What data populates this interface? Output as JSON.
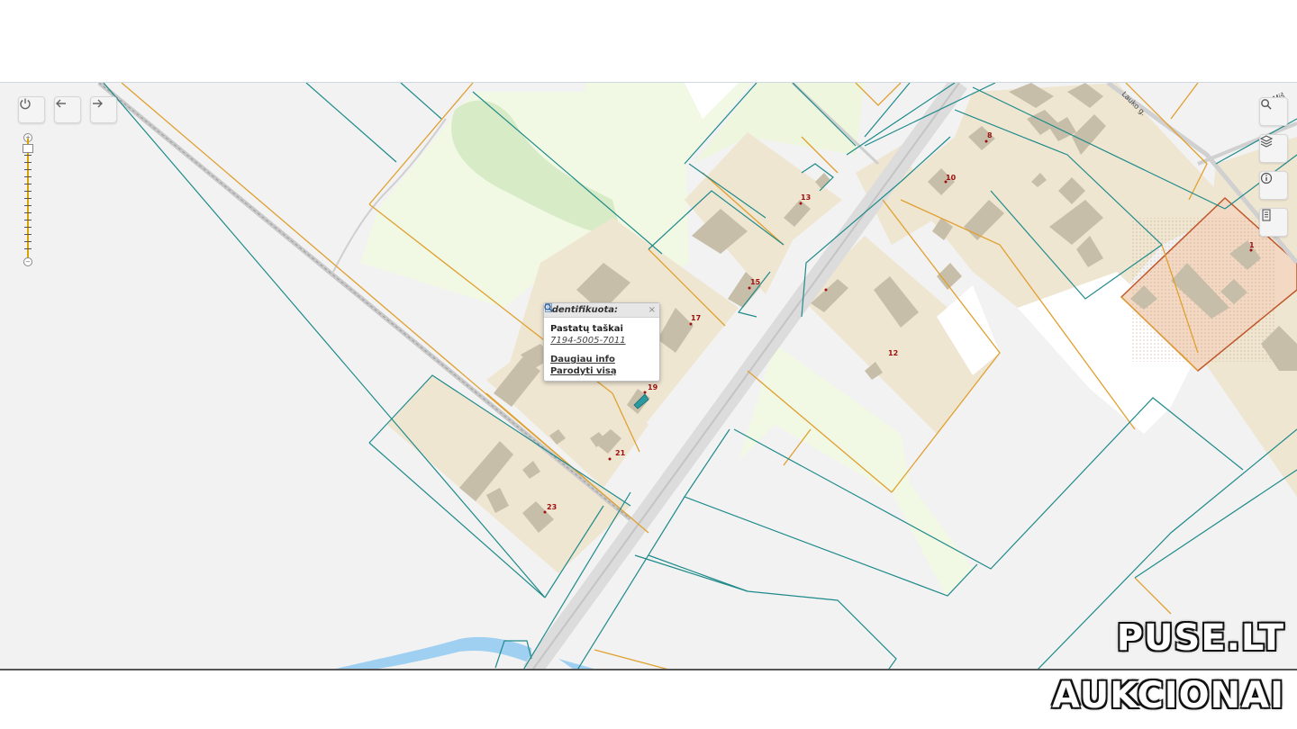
{
  "map": {
    "popup": {
      "header": "Identifikuota:",
      "close": "×",
      "title": "Pastatų taškai",
      "id_link": "7194-5005-7011",
      "more_info": "Daugiau info",
      "show_all": "Parodyti visą"
    },
    "address_labels": {
      "n1": "1",
      "n8": "8",
      "n10": "10",
      "n12": "12",
      "n13": "13",
      "n15": "15",
      "n17": "17",
      "n19": "19",
      "n21": "21",
      "n23": "23"
    },
    "streets": {
      "lauko": "Lauko g.",
      "misko": "Miš"
    },
    "controls": {
      "power_icon": "power-icon",
      "back_icon": "arrow-left-icon",
      "forward_icon": "arrow-right-icon",
      "search_icon": "search-icon",
      "layers_icon": "layers-icon",
      "info_icon": "info-icon",
      "legend_icon": "document-icon"
    },
    "colors": {
      "parcel_teal": "#1f8a8a",
      "parcel_orange": "#e0a030",
      "residential": "#efe6d2",
      "building": "#c7beaa",
      "green_area": "#f1f8e4",
      "forest": "#d6ebc6",
      "water": "#9fd0f2",
      "road": "#d9d9d9",
      "highlight": "#f3d9c4"
    }
  },
  "watermark": {
    "line1": "PUSE.LT",
    "line2": "AUKCIONAI"
  }
}
